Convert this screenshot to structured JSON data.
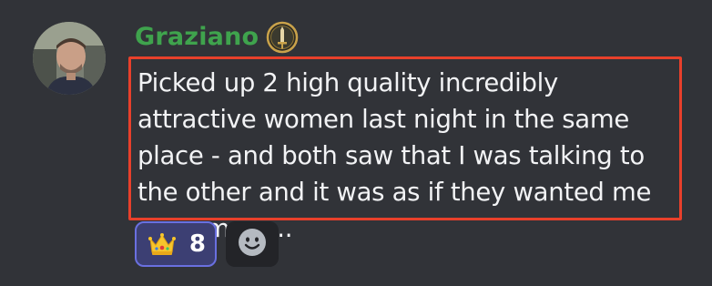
{
  "message": {
    "author": "Graziano",
    "author_color": "#3fa34d",
    "role_icon": "sword-badge-icon",
    "text": "Picked up 2 high quality incredibly attractive women last night in the same place - and both saw that I was talking to the other and it was as if they wanted me even more...",
    "highlight_color": "#e8402b"
  },
  "reactions": [
    {
      "emoji": "crown-emoji",
      "count": "8",
      "selected": true
    }
  ],
  "add_reaction_icon": "smiley-face-icon",
  "colors": {
    "background": "#313338",
    "reaction_selected_bg": "#3c3f73",
    "reaction_selected_border": "#6a70e0"
  }
}
